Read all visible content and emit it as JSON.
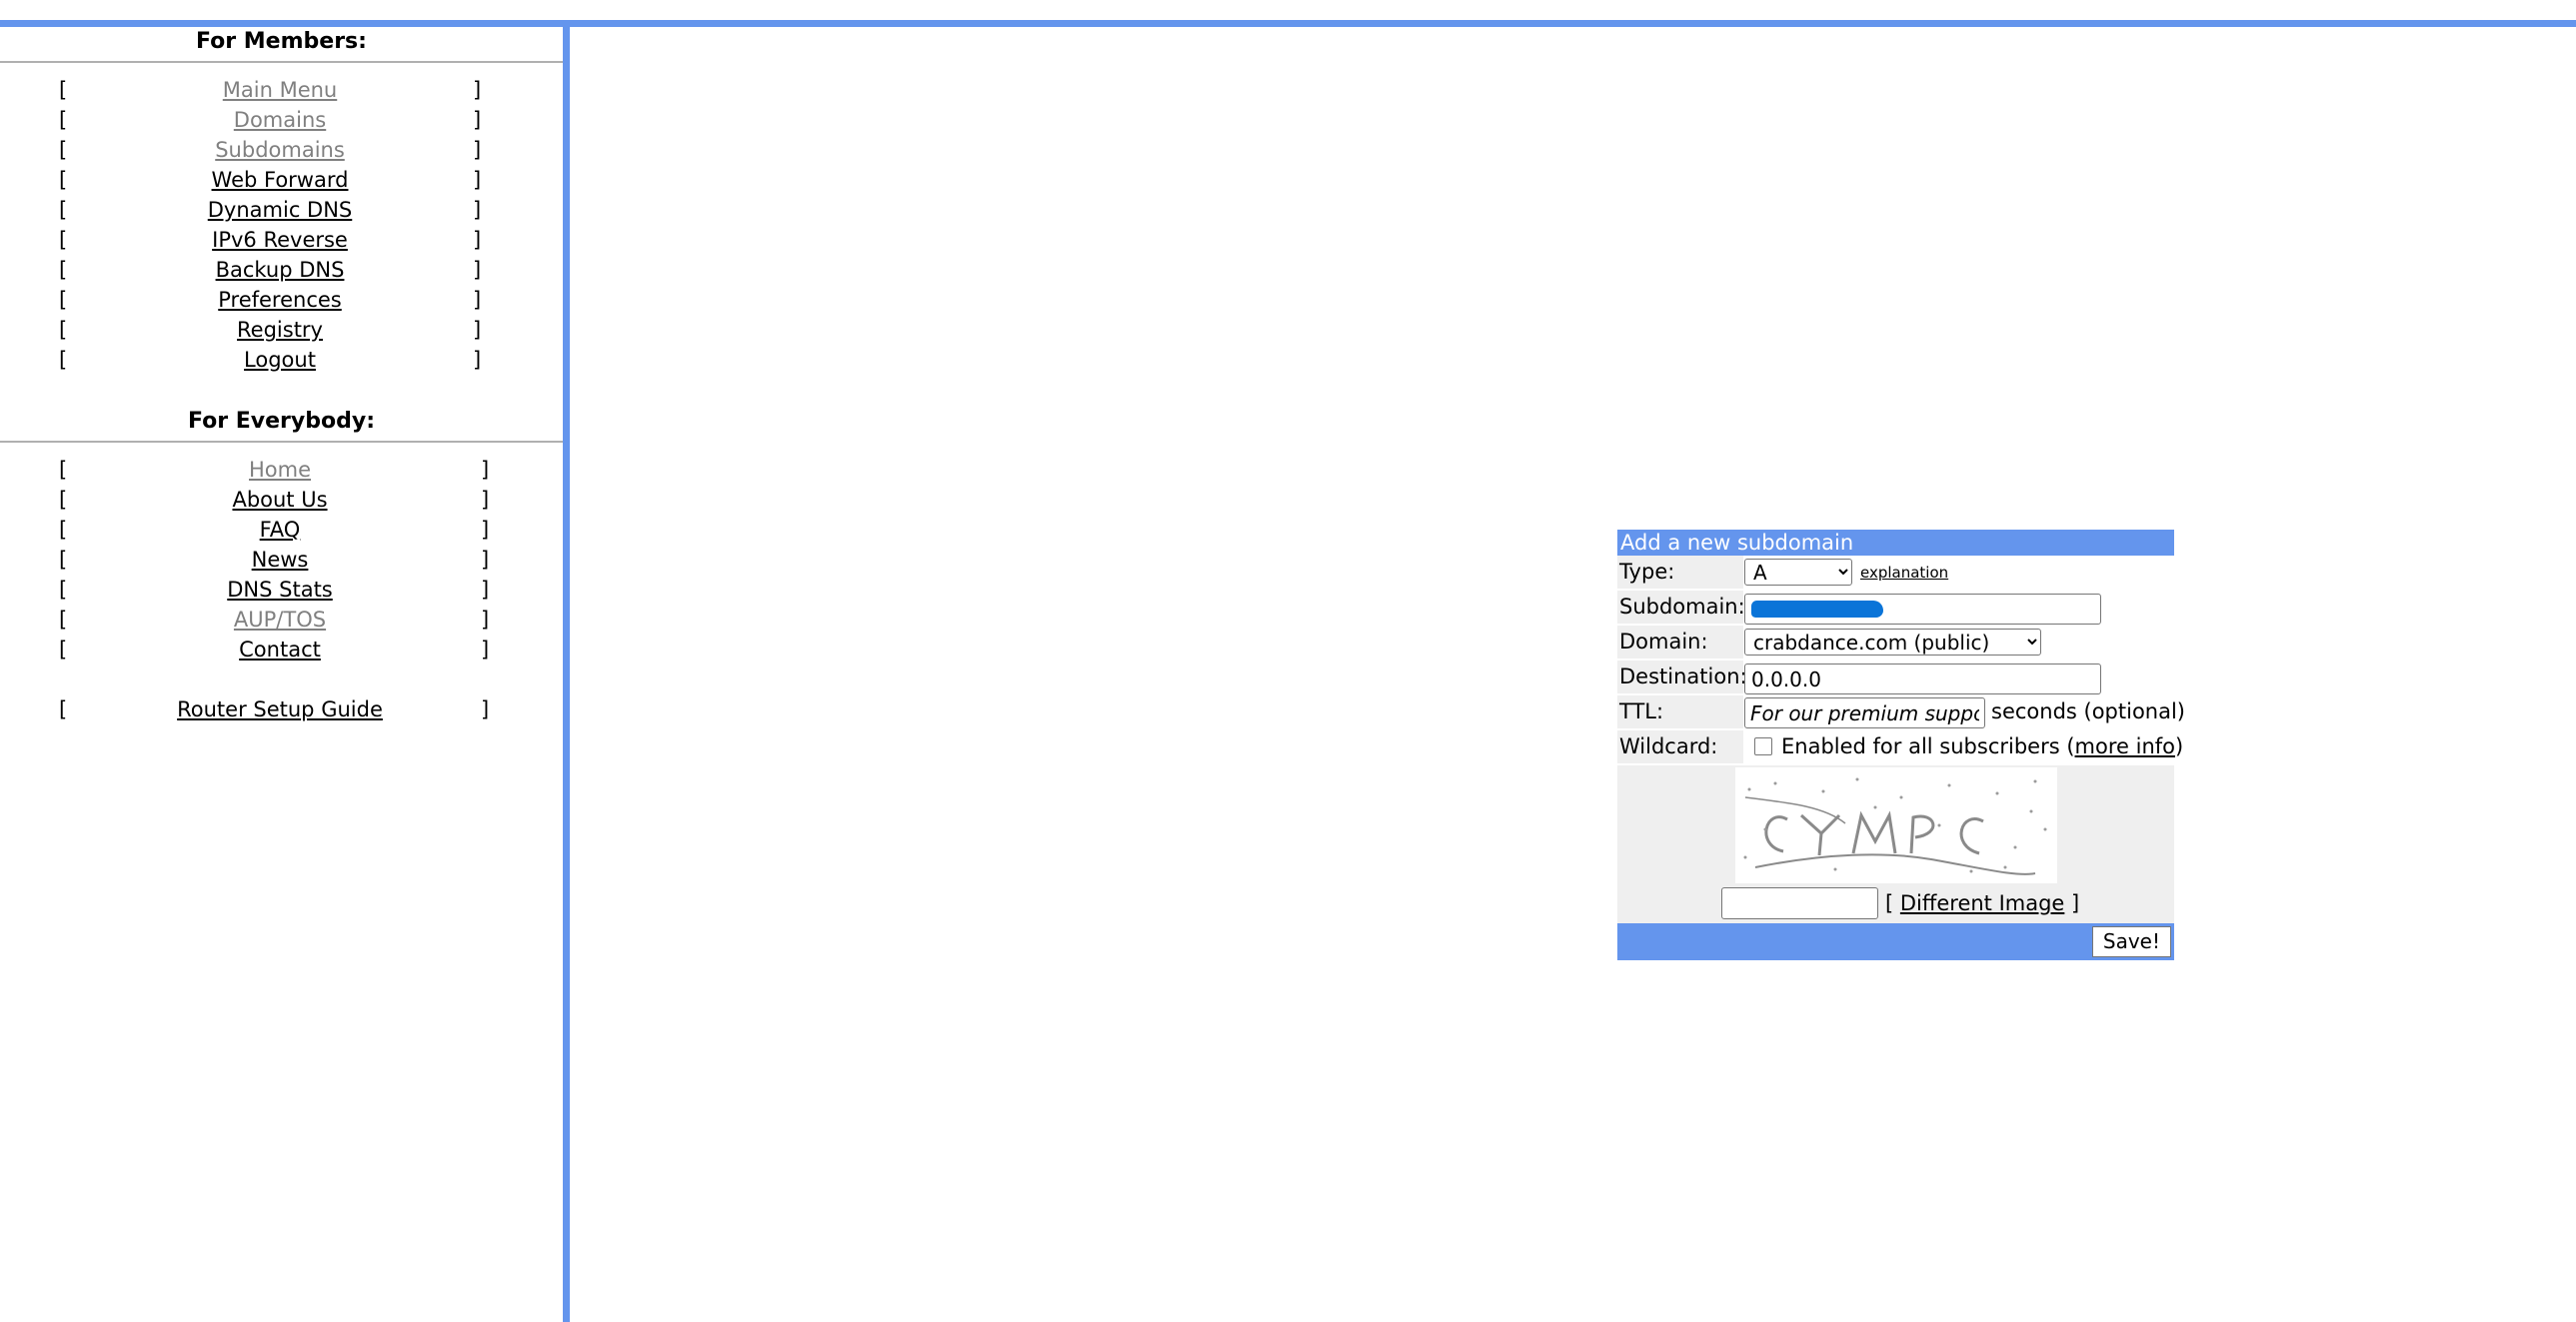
{
  "members": {
    "title": "For Members:",
    "items": [
      {
        "label": "Main Menu",
        "dim": true
      },
      {
        "label": "Domains",
        "dim": true
      },
      {
        "label": "Subdomains",
        "dim": true
      },
      {
        "label": "Web Forward",
        "dim": false
      },
      {
        "label": "Dynamic DNS",
        "dim": false
      },
      {
        "label": "IPv6 Reverse",
        "dim": false
      },
      {
        "label": "Backup DNS",
        "dim": false
      },
      {
        "label": "Preferences",
        "dim": false
      },
      {
        "label": "Registry",
        "dim": false
      },
      {
        "label": "Logout",
        "dim": false
      }
    ]
  },
  "everybody": {
    "title": "For Everybody:",
    "items": [
      {
        "label": "Home",
        "dim": true
      },
      {
        "label": "About Us",
        "dim": false
      },
      {
        "label": "FAQ",
        "dim": false
      },
      {
        "label": "News",
        "dim": false
      },
      {
        "label": "DNS Stats",
        "dim": false
      },
      {
        "label": "AUP/TOS",
        "dim": true
      },
      {
        "label": "Contact",
        "dim": false
      }
    ],
    "extra": {
      "label": "Router Setup Guide"
    }
  },
  "brackets": {
    "left": "[",
    "right": "]"
  },
  "form": {
    "title": "Add a new subdomain",
    "type_label": "Type:",
    "type_value": "A",
    "explanation": "explanation",
    "subdomain_label": "Subdomain:",
    "domain_label": "Domain:",
    "domain_value": "crabdance.com (public)",
    "destination_label": "Destination:",
    "destination_value": "0.0.0.0",
    "ttl_label": "TTL:",
    "ttl_value": "For our premium supporters",
    "ttl_suffix": "seconds (optional)",
    "wildcard_label": "Wildcard:",
    "wildcard_text": "Enabled for all subscribers (",
    "wildcard_more": "more info",
    "wildcard_close": ")",
    "captcha_value": "",
    "diff_open": "[ ",
    "diff_label": "Different Image",
    "diff_close": " ]",
    "save_label": "Save!"
  },
  "colors": {
    "accent": "#6495ed",
    "dim_link": "#808080",
    "label_bg": "#efefef",
    "redaction": "#0a74d8"
  }
}
